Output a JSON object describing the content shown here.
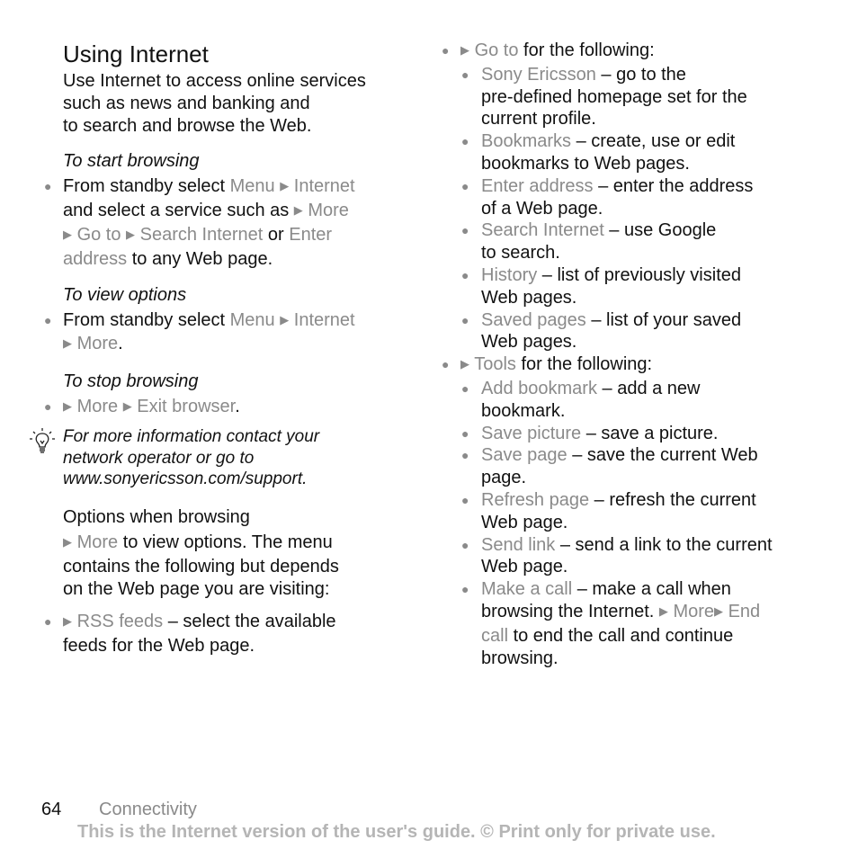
{
  "page": {
    "title": "Using Internet",
    "intro_lines": [
      "Use Internet to access online services",
      "such as news and banking and",
      "to search and browse the Web."
    ],
    "sections": {
      "start": {
        "heading": "To start browsing",
        "l1_a": "From standby select ",
        "l1_menu": "Menu",
        "l1_internet": "Internet",
        "l2_a": "and select a service such as ",
        "l2_more": "More",
        "l3_goto": "Go to",
        "l3_search": "Search Internet",
        "l3_or": " or ",
        "l3_enter": "Enter",
        "l4_address": "address",
        "l4_rest": " to any Web page."
      },
      "view": {
        "heading": "To view options",
        "l1_a": "From standby select ",
        "l1_menu": "Menu",
        "l1_internet": "Internet",
        "l2_more": "More",
        "l2_dot": "."
      },
      "stop": {
        "heading": "To stop browsing",
        "more": "More",
        "exit": "Exit browser",
        "dot": "."
      }
    },
    "tip": {
      "icon": "lightbulb-icon",
      "lines": [
        "For more information contact your",
        "network operator or go to",
        "www.sonyericsson.com/support."
      ]
    },
    "options": {
      "heading": "Options when browsing",
      "more": "More",
      "l1_rest": " to view options. The menu",
      "l2": "contains the following but depends",
      "l3": "on the Web page you are visiting:",
      "rss_label": "RSS feeds",
      "rss_l1_rest": " – select the available",
      "rss_l2": "feeds for the Web page."
    },
    "goto": {
      "label": "Go to",
      "rest": " for the following:",
      "items": [
        {
          "label": "Sony Ericsson",
          "lines": [
            " – go to the",
            "pre-defined homepage set for the",
            "current profile."
          ]
        },
        {
          "label": "Bookmarks",
          "lines": [
            " – create, use or edit",
            "bookmarks to Web pages."
          ]
        },
        {
          "label": "Enter address",
          "lines": [
            " – enter the address",
            "of a Web page."
          ]
        },
        {
          "label": "Search Internet",
          "lines": [
            " – use Google",
            "to search."
          ]
        },
        {
          "label": "History",
          "lines": [
            " – list of previously visited",
            "Web pages."
          ]
        },
        {
          "label": "Saved pages",
          "lines": [
            " – list of your saved",
            "Web pages."
          ]
        }
      ]
    },
    "tools": {
      "label": "Tools",
      "rest": " for the following:",
      "items": [
        {
          "label": "Add bookmark",
          "lines": [
            " – add a new",
            "bookmark."
          ]
        },
        {
          "label": "Save picture",
          "lines": [
            " – save a picture."
          ]
        },
        {
          "label": "Save page",
          "lines": [
            " – save the current Web",
            "page."
          ]
        },
        {
          "label": "Refresh page",
          "lines": [
            " – refresh the current",
            "Web page."
          ]
        },
        {
          "label": "Send link",
          "lines": [
            " – send a link to the current",
            "Web page."
          ]
        }
      ],
      "call": {
        "label": "Make a call",
        "l1": " – make a call when",
        "l2_a": "browsing the Internet. ",
        "l2_more": "More",
        "l2_end": "End",
        "l3_call": "call",
        "l3_rest": " to end the call and continue",
        "l4": "browsing."
      }
    },
    "footer": {
      "page_number": "64",
      "section": "Connectivity",
      "note": "This is the Internet version of the user's guide. © Print only for private use."
    },
    "symbols": {
      "bullet": "●",
      "arrow": "▶"
    },
    "colors": {
      "text": "#111111",
      "menu_item": "#8a8a8a",
      "watermark": "#b5b5b5"
    }
  }
}
